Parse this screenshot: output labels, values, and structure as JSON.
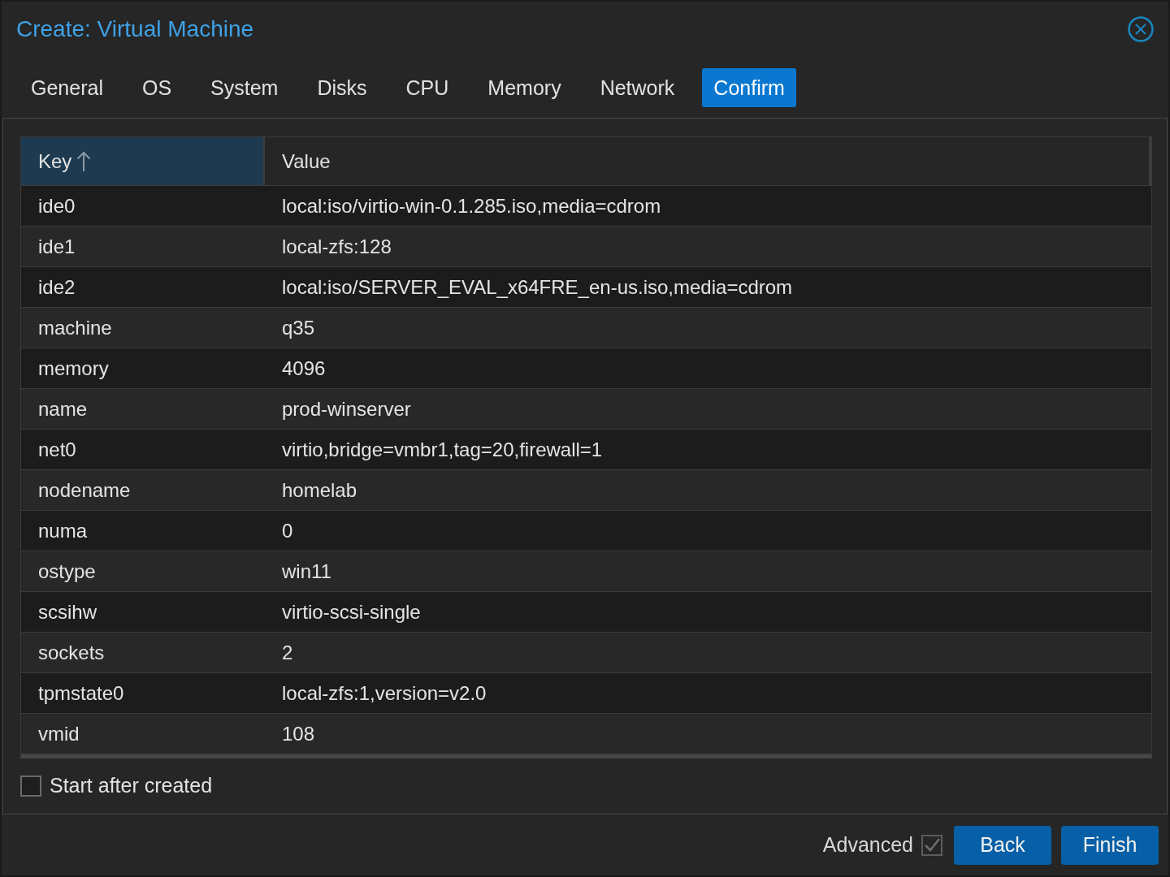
{
  "window": {
    "title": "Create: Virtual Machine"
  },
  "tabs": [
    {
      "label": "General",
      "selected": false
    },
    {
      "label": "OS",
      "selected": false
    },
    {
      "label": "System",
      "selected": false
    },
    {
      "label": "Disks",
      "selected": false
    },
    {
      "label": "CPU",
      "selected": false
    },
    {
      "label": "Memory",
      "selected": false
    },
    {
      "label": "Network",
      "selected": false
    },
    {
      "label": "Confirm",
      "selected": true
    }
  ],
  "table": {
    "columns": [
      {
        "label": "Key",
        "sorted": true
      },
      {
        "label": "Value",
        "sorted": false
      }
    ],
    "rows": [
      {
        "key": "ide0",
        "value": "local:iso/virtio-win-0.1.285.iso,media=cdrom"
      },
      {
        "key": "ide1",
        "value": "local-zfs:128"
      },
      {
        "key": "ide2",
        "value": "local:iso/SERVER_EVAL_x64FRE_en-us.iso,media=cdrom"
      },
      {
        "key": "machine",
        "value": "q35"
      },
      {
        "key": "memory",
        "value": "4096"
      },
      {
        "key": "name",
        "value": "prod-winserver"
      },
      {
        "key": "net0",
        "value": "virtio,bridge=vmbr1,tag=20,firewall=1"
      },
      {
        "key": "nodename",
        "value": "homelab"
      },
      {
        "key": "numa",
        "value": "0"
      },
      {
        "key": "ostype",
        "value": "win11"
      },
      {
        "key": "scsihw",
        "value": "virtio-scsi-single"
      },
      {
        "key": "sockets",
        "value": "2"
      },
      {
        "key": "tpmstate0",
        "value": "local-zfs:1,version=v2.0"
      },
      {
        "key": "vmid",
        "value": "108"
      }
    ]
  },
  "start_after_created": {
    "label": "Start after created",
    "checked": false
  },
  "footer": {
    "advanced": {
      "label": "Advanced",
      "checked": true
    },
    "buttons": [
      {
        "label": "Back"
      },
      {
        "label": "Finish"
      }
    ]
  }
}
